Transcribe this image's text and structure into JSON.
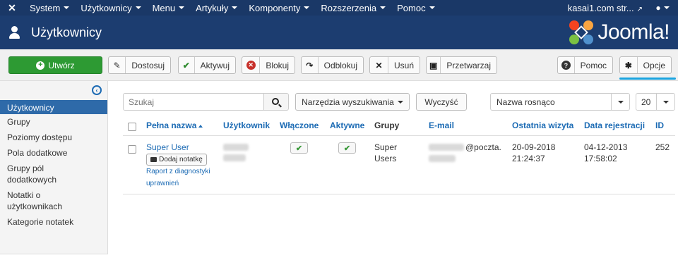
{
  "navbar": {
    "logo_icon": "joomla-icon",
    "menus": [
      "System",
      "Użytkownicy",
      "Menu",
      "Artykuły",
      "Komponenty",
      "Rozszerzenia",
      "Pomoc"
    ],
    "site_link": "kasai1.com str...",
    "user_icon": "user-icon"
  },
  "header": {
    "title": "Użytkownicy",
    "brand": "Joomla!"
  },
  "toolbar": {
    "new": "Utwórz",
    "edit": "Dostosuj",
    "activate": "Aktywuj",
    "block": "Blokuj",
    "unblock": "Odblokuj",
    "delete": "Usuń",
    "batch": "Przetwarzaj",
    "help": "Pomoc",
    "options": "Opcje"
  },
  "sidebar": {
    "items": [
      {
        "label": "Użytkownicy",
        "active": true
      },
      {
        "label": "Grupy",
        "active": false
      },
      {
        "label": "Poziomy dostępu",
        "active": false
      },
      {
        "label": "Pola dodatkowe",
        "active": false
      },
      {
        "label": "Grupy pól dodatkowych",
        "active": false
      },
      {
        "label": "Notatki o użytkownikach",
        "active": false
      },
      {
        "label": "Kategorie notatek",
        "active": false
      }
    ]
  },
  "filters": {
    "search_placeholder": "Szukaj",
    "search_tools": "Narzędzia wyszukiwania",
    "clear": "Wyczyść",
    "sort": "Nazwa rosnąco",
    "limit": "20"
  },
  "table": {
    "headers": {
      "name": "Pełna nazwa",
      "username": "Użytkownik",
      "enabled": "Włączone",
      "activated": "Aktywne",
      "groups": "Grupy",
      "email": "E-mail",
      "last_visit": "Ostatnia wizyta",
      "registered": "Data rejestracji",
      "id": "ID"
    },
    "rows": [
      {
        "name": "Super User",
        "add_note": "Dodaj notatkę",
        "diagnostics_line1": "Raport z diagnostyki",
        "diagnostics_line2": "uprawnień",
        "groups_line1": "Super",
        "groups_line2": "Users",
        "email_visible": "@poczta.",
        "last_visit_date": "20-09-2018",
        "last_visit_time": "21:24:37",
        "registered_date": "04-12-2013",
        "registered_time": "17:58:02",
        "id": "252"
      }
    ]
  },
  "colors": {
    "navbar": "#1a3867",
    "header": "#1c3d70",
    "new_button": "#2d9a33",
    "link": "#1c6bb4",
    "sidebar_active": "#2e6aa9",
    "options_accent": "#1aa4e0"
  }
}
